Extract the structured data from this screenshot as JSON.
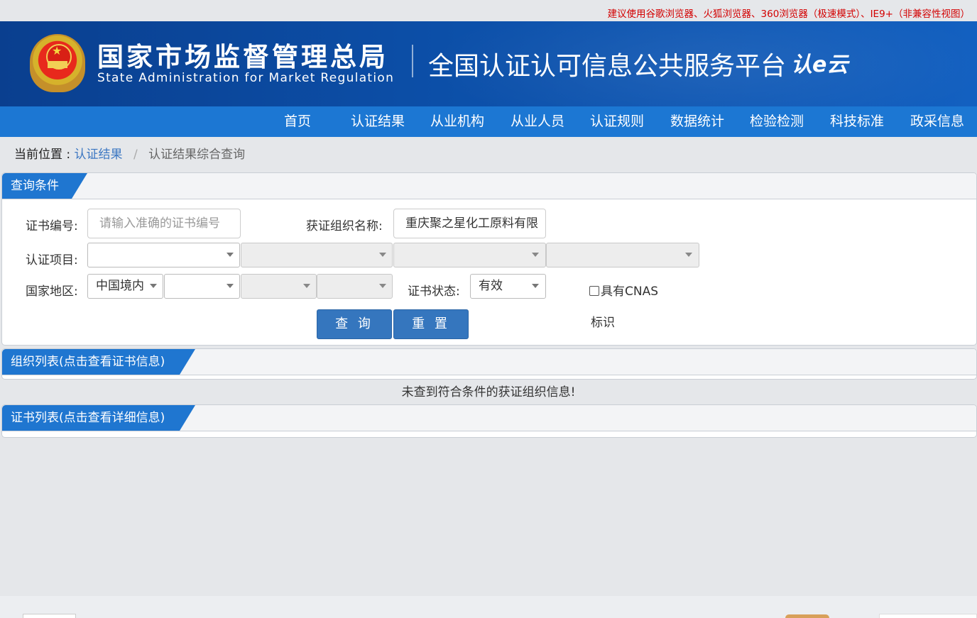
{
  "notice": "建议使用谷歌浏览器、火狐浏览器、360浏览器（极速模式）、IE9+（非兼容性视图）",
  "header": {
    "title_cn": "国家市场监督管理总局",
    "title_en": "State Administration  for  Market Regulation",
    "platform": "全国认证认可信息公共服务平台",
    "logo_text": "认e云",
    "emblem_icon": "national-emblem-icon"
  },
  "nav": {
    "items": [
      "首页",
      "认证结果",
      "从业机构",
      "从业人员",
      "认证规则",
      "数据统计",
      "检验检测",
      "科技标准",
      "政采信息"
    ]
  },
  "breadcrumb": {
    "label": "当前位置 :",
    "link": "认证结果",
    "separator": "/",
    "current": "认证结果综合查询"
  },
  "query_panel": {
    "title": "查询条件",
    "cert_no_label": "证书编号:",
    "cert_no_placeholder": "请输入准确的证书编号",
    "org_name_label": "获证组织名称:",
    "org_name_value": "重庆聚之星化工原料有限",
    "project_label": "认证项目:",
    "project_selects": [
      "",
      "",
      "",
      ""
    ],
    "region_label": "国家地区:",
    "region_selects": [
      "中国境内",
      "",
      "",
      ""
    ],
    "status_label": "证书状态:",
    "status_value": "有效",
    "cnas_label": "具有CNAS",
    "cnas_label_2": "标识",
    "cnas_checked": false,
    "search_button": "查 询",
    "reset_button": "重 置"
  },
  "org_panel": {
    "title": "组织列表(点击查看证书信息)",
    "empty_message": "未查到符合条件的获证组织信息!"
  },
  "cert_panel": {
    "title": "证书列表(点击查看详细信息)"
  },
  "colors": {
    "banner": "#0c4fa8",
    "nav": "#1c77d3",
    "panel_tag": "#1f76d0",
    "button": "#3576be",
    "notice": "#d30000",
    "link": "#3c77c2"
  }
}
